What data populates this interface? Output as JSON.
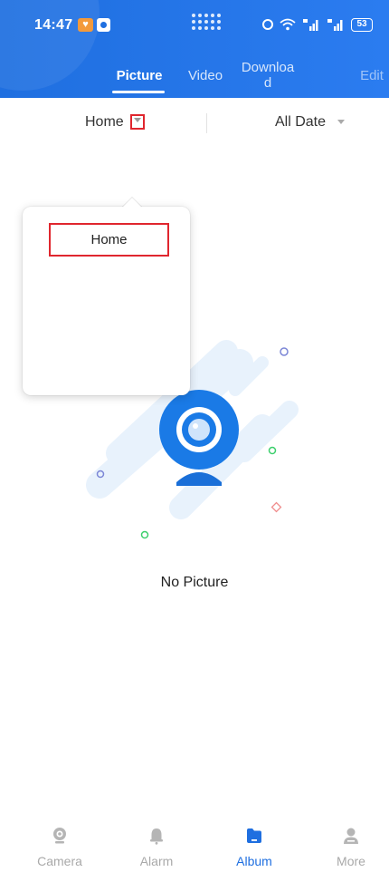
{
  "status_bar": {
    "time": "14:47",
    "battery": "53"
  },
  "tabs": {
    "picture": "Picture",
    "video": "Video",
    "download": "Download",
    "edit": "Edit"
  },
  "filter": {
    "device": "Home",
    "date": "All Date"
  },
  "dropdown": {
    "items": [
      "Home"
    ]
  },
  "empty_state": {
    "message": "No Picture"
  },
  "bottom_nav": {
    "items": [
      {
        "label": "Camera",
        "icon": "camera-icon",
        "active": false
      },
      {
        "label": "Alarm",
        "icon": "bell-icon",
        "active": false
      },
      {
        "label": "Album",
        "icon": "album-icon",
        "active": true
      },
      {
        "label": "More",
        "icon": "person-icon",
        "active": false
      }
    ]
  },
  "colors": {
    "primary": "#1f6fe0",
    "highlight_box": "#e0262e",
    "inactive_nav": "#a9a9a9"
  }
}
